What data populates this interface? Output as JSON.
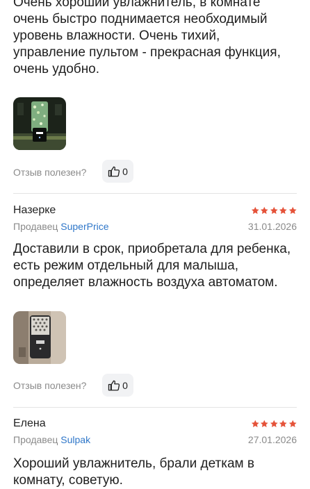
{
  "reviews": [
    {
      "text": "Очень хороший увлажнитель, в комнате\nочень быстро поднимается необходимый\nуровень влажности. Очень тихий,\nуправление пультом - прекрасная функция,\nочень удобно.",
      "helpful_label": "Отзыв полезен?",
      "likes": "0"
    },
    {
      "author": "Назерке",
      "rating": 5,
      "seller_prefix": "Продавец",
      "seller": "SuperPrice",
      "date": "31.01.2026",
      "text": "Доставили в срок, приобретала для ребенка,\nесть режим отдельный для малыша,\nопределяет влажность воздуха автоматом.",
      "helpful_label": "Отзыв полезен?",
      "likes": "0"
    },
    {
      "author": "Елена",
      "rating": 5,
      "seller_prefix": "Продавец",
      "seller": "Sulpak",
      "date": "27.01.2026",
      "text": "Хороший увлажнитель, брали деткам в\nкомнату, советую."
    }
  ],
  "icons": {
    "like": "thumbs-up-icon",
    "star": "star-icon"
  },
  "colors": {
    "star": "#e5533a",
    "link": "#2f77c9",
    "muted": "#8a8a8a"
  }
}
